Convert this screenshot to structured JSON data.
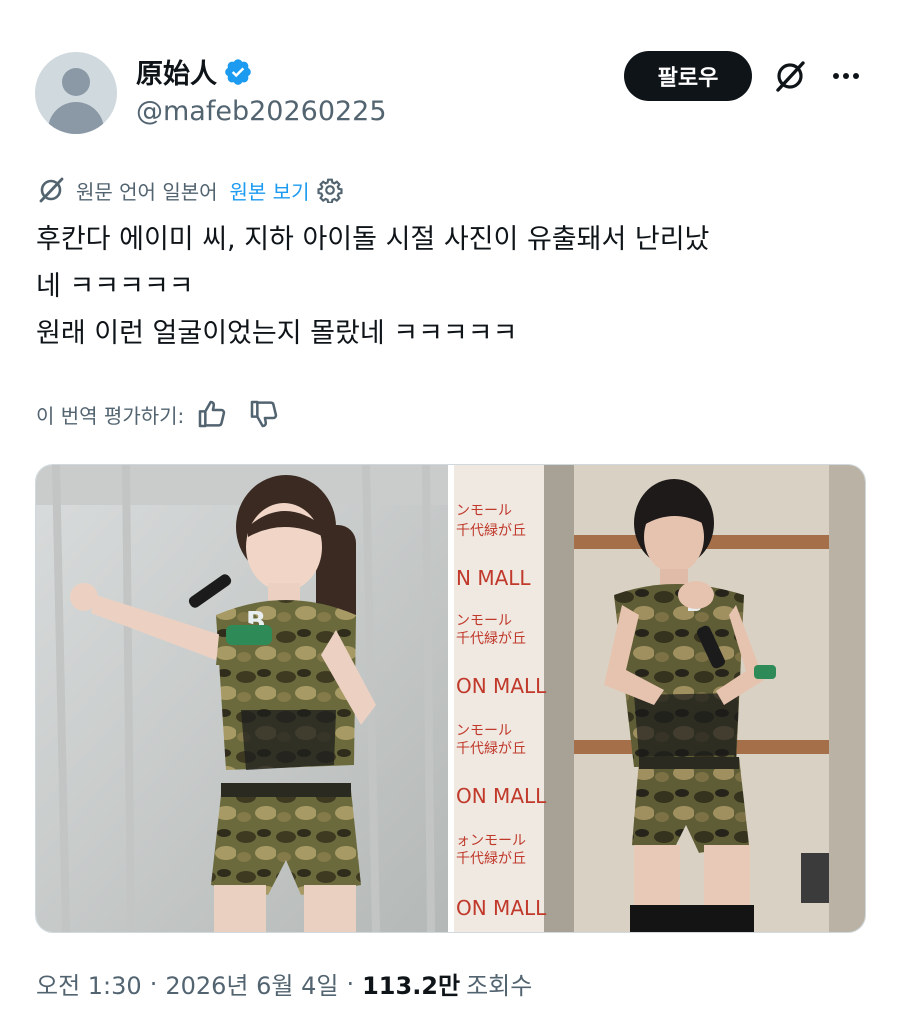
{
  "author": {
    "display_name": "原始人",
    "handle": "@mafeb20260225",
    "verified": true,
    "avatar_icon": "default-avatar-icon"
  },
  "actions": {
    "follow_label": "팔로우",
    "grok_icon": "grok-icon",
    "more_icon": "more-dots-icon"
  },
  "translation": {
    "note": "원문 언어 일본어",
    "show_original_label": "원본 보기",
    "settings_icon": "gear-icon"
  },
  "tweet": {
    "lines": [
      "후칸다 에이미 씨, 지하 아이돌 시절 사진이 유출돼서 난리났",
      "네 ㅋㅋㅋㅋㅋ",
      "원래 이런 얼굴이었는지 몰랐네 ㅋㅋㅋㅋㅋ"
    ]
  },
  "rating": {
    "label": "이 번역 평가하기:",
    "thumbs_up_icon": "thumbs-up-icon",
    "thumbs_down_icon": "thumbs-down-icon"
  },
  "media": {
    "left_badge": "B",
    "right_badge": "B",
    "right_sign_lines": [
      "ンモール",
      "千代緑が丘",
      "N MALL",
      "ンモール",
      "千代緑が丘",
      "ON MALL",
      "ンモール",
      "千代緑が丘",
      "ON MALL",
      "ォンモール",
      "千代緑が丘",
      "ON MALL"
    ]
  },
  "meta": {
    "time": "오전 1:30",
    "date": "2026년 6월 4일",
    "views_count": "113.2만",
    "views_label": "조회수",
    "separator": "·"
  },
  "colors": {
    "accent": "#1d9bf0",
    "text": "#0f1419",
    "secondary": "#536471",
    "button_bg": "#0f1419"
  }
}
